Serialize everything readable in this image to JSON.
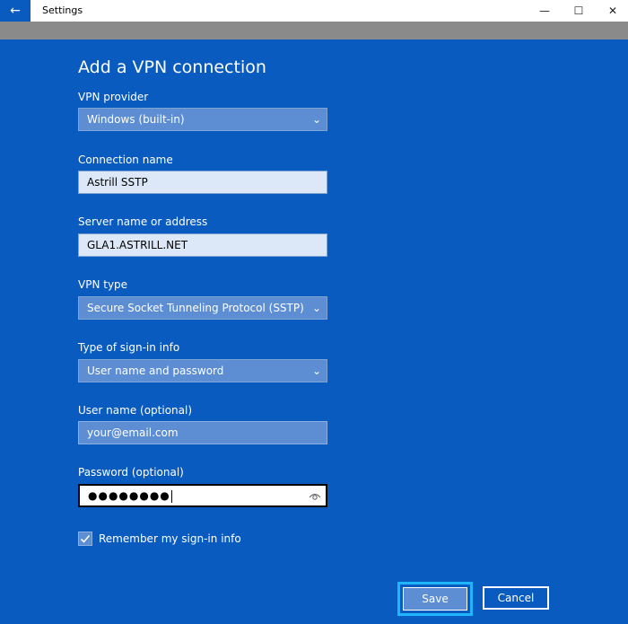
{
  "window": {
    "title": "Settings",
    "back_icon": "←",
    "minimize_icon": "—",
    "maximize_icon": "☐",
    "close_icon": "✕"
  },
  "page": {
    "title": "Add a VPN connection"
  },
  "form": {
    "vpn_provider": {
      "label": "VPN provider",
      "value": "Windows (built-in)"
    },
    "connection_name": {
      "label": "Connection name",
      "value": "Astrill SSTP"
    },
    "server": {
      "label": "Server name or address",
      "value": "GLA1.ASTRILL.NET"
    },
    "vpn_type": {
      "label": "VPN type",
      "value": "Secure Socket Tunneling Protocol (SSTP)"
    },
    "signin_type": {
      "label": "Type of sign-in info",
      "value": "User name and password"
    },
    "username": {
      "label": "User name (optional)",
      "value": "your@email.com"
    },
    "password": {
      "label": "Password (optional)",
      "value": "●●●●●●●●"
    },
    "remember": {
      "label": "Remember my sign-in info",
      "checked": true
    }
  },
  "buttons": {
    "save": "Save",
    "cancel": "Cancel"
  },
  "colors": {
    "background": "#0a5bc0",
    "field": "#5d8ed4",
    "accent_focus": "#1fb6ff"
  }
}
